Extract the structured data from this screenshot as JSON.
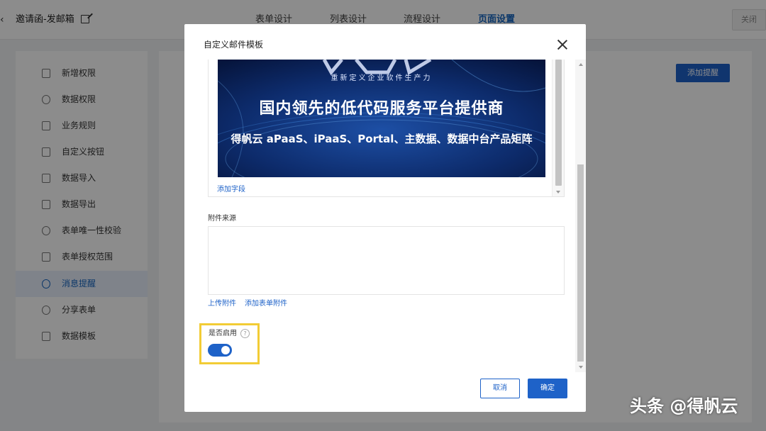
{
  "topbar": {
    "title": "邀请函-发邮箱",
    "tabs": [
      {
        "label": "表单设计"
      },
      {
        "label": "列表设计"
      },
      {
        "label": "流程设计"
      },
      {
        "label": "页面设置"
      }
    ],
    "active_tab": "页面设置",
    "close_label": "关闭"
  },
  "sidebar": {
    "items": [
      {
        "label": "新增权限",
        "icon": "file-plus-icon"
      },
      {
        "label": "数据权限",
        "icon": "shield-icon"
      },
      {
        "label": "业务规则",
        "icon": "sliders-icon"
      },
      {
        "label": "自定义按钮",
        "icon": "button-icon"
      },
      {
        "label": "数据导入",
        "icon": "import-icon"
      },
      {
        "label": "数据导出",
        "icon": "export-icon"
      },
      {
        "label": "表单唯一性校验",
        "icon": "check-icon"
      },
      {
        "label": "表单授权范围",
        "icon": "auth-icon"
      },
      {
        "label": "消息提醒",
        "icon": "alarm-icon"
      },
      {
        "label": "分享表单",
        "icon": "share-icon"
      },
      {
        "label": "数据模板",
        "icon": "template-icon"
      }
    ],
    "active_item": "消息提醒"
  },
  "main": {
    "add_reminder_label": "添加提醒"
  },
  "modal": {
    "title": "自定义邮件模板",
    "banner": {
      "slogan": "重新定义企业软件生产力",
      "title": "国内领先的低代码服务平台提供商",
      "subtitle": "得帆云 aPaaS、iPaaS、Portal、主数据、数据中台产品矩阵"
    },
    "add_field_label": "添加字段",
    "attachment_label": "附件来源",
    "upload_label": "上传附件",
    "add_form_attachment_label": "添加表单附件",
    "enable_label": "是否启用",
    "enabled": true,
    "cancel_label": "取消",
    "ok_label": "确定"
  },
  "watermark": "头条 @得帆云",
  "colors": {
    "accent": "#1e62c8",
    "highlight_border": "#f2cc35"
  }
}
